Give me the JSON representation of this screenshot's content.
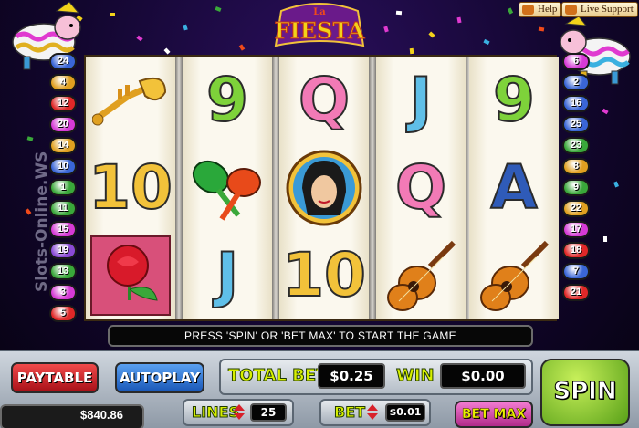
{
  "game": {
    "logo_text": "FIESTA",
    "logo_small": "La",
    "watermark": "Slots-Online.WS"
  },
  "top_links": {
    "help": "Help",
    "live_support": "Live Support"
  },
  "left_lines": [
    "24",
    "4",
    "12",
    "20",
    "14",
    "10",
    "1",
    "11",
    "15",
    "19",
    "13",
    "3",
    "5"
  ],
  "right_lines": [
    "6",
    "2",
    "16",
    "25",
    "23",
    "8",
    "9",
    "22",
    "17",
    "18",
    "7",
    "21"
  ],
  "left_line_colors": [
    "#3a66d6",
    "#e0a020",
    "#e02828",
    "#d63ad6",
    "#e0a020",
    "#3a66d6",
    "#3aa83a",
    "#3aa83a",
    "#d63ad6",
    "#8a4ad6",
    "#3aa83a",
    "#d63ad6",
    "#e02828"
  ],
  "right_line_colors": [
    "#d63ad6",
    "#3a66d6",
    "#3a66d6",
    "#3a66d6",
    "#3aa83a",
    "#e0a020",
    "#3aa83a",
    "#e0a020",
    "#d63ad6",
    "#e02828",
    "#3a66d6",
    "#e02828"
  ],
  "reels": [
    [
      {
        "icon": "trumpet-icon"
      },
      {
        "text": "10",
        "color": "gold"
      },
      {
        "icon": "rose-icon"
      }
    ],
    [
      {
        "text": "9",
        "color": "green"
      },
      {
        "icon": "maracas-icon"
      },
      {
        "text": "J",
        "color": "blue"
      }
    ],
    [
      {
        "text": "Q",
        "color": "pink"
      },
      {
        "icon": "senorita-icon"
      },
      {
        "text": "10",
        "color": "gold"
      }
    ],
    [
      {
        "text": "J",
        "color": "blue"
      },
      {
        "text": "Q",
        "color": "pink"
      },
      {
        "icon": "guitar-icon"
      }
    ],
    [
      {
        "text": "9",
        "color": "green"
      },
      {
        "text": "A",
        "color": "navy"
      },
      {
        "icon": "guitar-icon"
      }
    ]
  ],
  "message": "PRESS 'SPIN' OR 'BET MAX' TO START THE GAME",
  "controls": {
    "paytable": "PAYTABLE",
    "autoplay": "AUTOPLAY",
    "total_bet_label": "TOTAL BET",
    "total_bet_value": "$0.25",
    "win_label": "WIN",
    "win_value": "$0.00",
    "spin": "SPIN",
    "lines_label": "LINES",
    "lines_value": "25",
    "bet_label": "BET",
    "bet_value": "$0.01",
    "bet_max": "BET MAX",
    "balance_partial": "$840.86"
  },
  "colors": {
    "accent_yellow": "#d8f000",
    "paytable_red": "#c8202a",
    "autoplay_blue": "#2a6fd0",
    "spin_green": "#8ad62a",
    "betmax_pink": "#d84aa8"
  }
}
